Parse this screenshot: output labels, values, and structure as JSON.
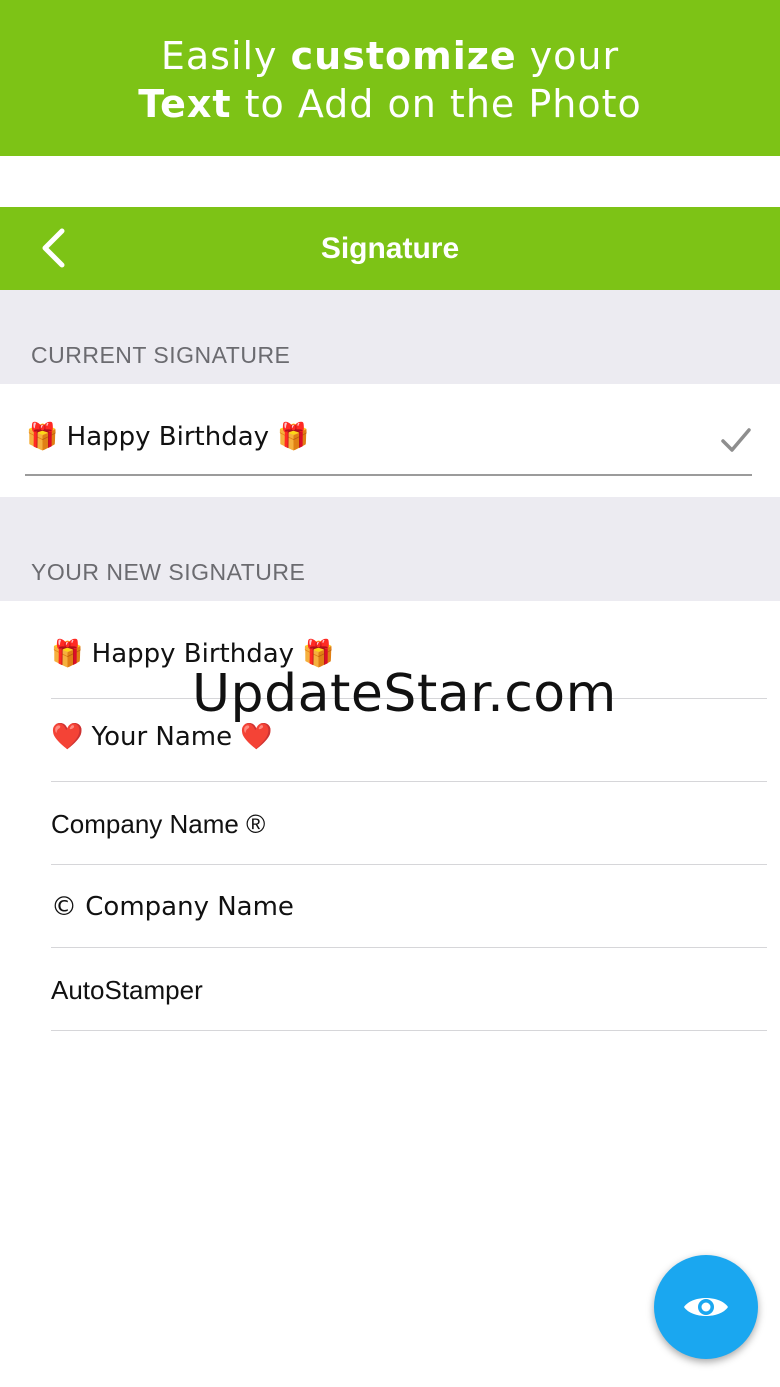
{
  "promo": {
    "line1_pre": "Easily ",
    "line1_bold": "customize",
    "line1_post": " your",
    "line2_bold": "Text",
    "line2_post": " to Add on the Photo"
  },
  "nav": {
    "title": "Signature",
    "back_icon": "chevron-left-icon"
  },
  "current_section": {
    "header": "CURRENT SIGNATURE",
    "value": "🎁 Happy Birthday 🎁",
    "check_icon": "checkmark-icon"
  },
  "new_section": {
    "header": "YOUR NEW SIGNATURE",
    "items": [
      {
        "label": "🎁 Happy Birthday 🎁"
      },
      {
        "label": "❤️ Your Name ❤️"
      },
      {
        "label": "Company Name ®"
      },
      {
        "label": "© Company Name"
      },
      {
        "label": "AutoStamper"
      }
    ]
  },
  "watermark": "UpdateStar.com",
  "fab": {
    "icon": "eye-icon"
  },
  "colors": {
    "brand_green": "#7dc316",
    "section_bg": "#ecebf1",
    "fab_blue": "#1aa7f0"
  }
}
